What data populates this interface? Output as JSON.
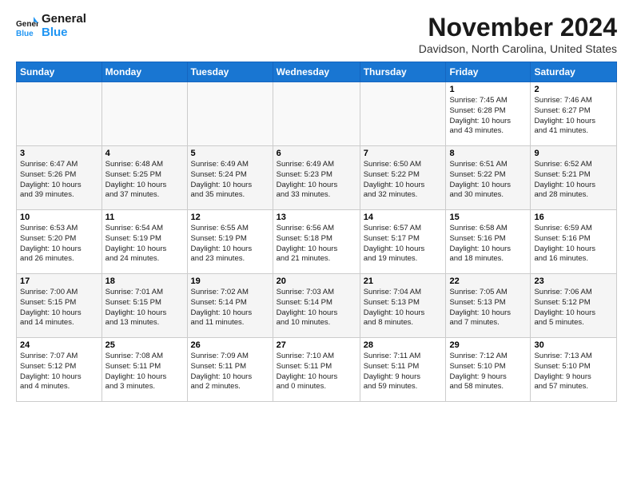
{
  "logo": {
    "line1": "General",
    "line2": "Blue"
  },
  "title": "November 2024",
  "subtitle": "Davidson, North Carolina, United States",
  "header": {
    "days": [
      "Sunday",
      "Monday",
      "Tuesday",
      "Wednesday",
      "Thursday",
      "Friday",
      "Saturday"
    ]
  },
  "weeks": [
    [
      {
        "day": "",
        "info": ""
      },
      {
        "day": "",
        "info": ""
      },
      {
        "day": "",
        "info": ""
      },
      {
        "day": "",
        "info": ""
      },
      {
        "day": "",
        "info": ""
      },
      {
        "day": "1",
        "info": "Sunrise: 7:45 AM\nSunset: 6:28 PM\nDaylight: 10 hours\nand 43 minutes."
      },
      {
        "day": "2",
        "info": "Sunrise: 7:46 AM\nSunset: 6:27 PM\nDaylight: 10 hours\nand 41 minutes."
      }
    ],
    [
      {
        "day": "3",
        "info": "Sunrise: 6:47 AM\nSunset: 5:26 PM\nDaylight: 10 hours\nand 39 minutes."
      },
      {
        "day": "4",
        "info": "Sunrise: 6:48 AM\nSunset: 5:25 PM\nDaylight: 10 hours\nand 37 minutes."
      },
      {
        "day": "5",
        "info": "Sunrise: 6:49 AM\nSunset: 5:24 PM\nDaylight: 10 hours\nand 35 minutes."
      },
      {
        "day": "6",
        "info": "Sunrise: 6:49 AM\nSunset: 5:23 PM\nDaylight: 10 hours\nand 33 minutes."
      },
      {
        "day": "7",
        "info": "Sunrise: 6:50 AM\nSunset: 5:22 PM\nDaylight: 10 hours\nand 32 minutes."
      },
      {
        "day": "8",
        "info": "Sunrise: 6:51 AM\nSunset: 5:22 PM\nDaylight: 10 hours\nand 30 minutes."
      },
      {
        "day": "9",
        "info": "Sunrise: 6:52 AM\nSunset: 5:21 PM\nDaylight: 10 hours\nand 28 minutes."
      }
    ],
    [
      {
        "day": "10",
        "info": "Sunrise: 6:53 AM\nSunset: 5:20 PM\nDaylight: 10 hours\nand 26 minutes."
      },
      {
        "day": "11",
        "info": "Sunrise: 6:54 AM\nSunset: 5:19 PM\nDaylight: 10 hours\nand 24 minutes."
      },
      {
        "day": "12",
        "info": "Sunrise: 6:55 AM\nSunset: 5:19 PM\nDaylight: 10 hours\nand 23 minutes."
      },
      {
        "day": "13",
        "info": "Sunrise: 6:56 AM\nSunset: 5:18 PM\nDaylight: 10 hours\nand 21 minutes."
      },
      {
        "day": "14",
        "info": "Sunrise: 6:57 AM\nSunset: 5:17 PM\nDaylight: 10 hours\nand 19 minutes."
      },
      {
        "day": "15",
        "info": "Sunrise: 6:58 AM\nSunset: 5:16 PM\nDaylight: 10 hours\nand 18 minutes."
      },
      {
        "day": "16",
        "info": "Sunrise: 6:59 AM\nSunset: 5:16 PM\nDaylight: 10 hours\nand 16 minutes."
      }
    ],
    [
      {
        "day": "17",
        "info": "Sunrise: 7:00 AM\nSunset: 5:15 PM\nDaylight: 10 hours\nand 14 minutes."
      },
      {
        "day": "18",
        "info": "Sunrise: 7:01 AM\nSunset: 5:15 PM\nDaylight: 10 hours\nand 13 minutes."
      },
      {
        "day": "19",
        "info": "Sunrise: 7:02 AM\nSunset: 5:14 PM\nDaylight: 10 hours\nand 11 minutes."
      },
      {
        "day": "20",
        "info": "Sunrise: 7:03 AM\nSunset: 5:14 PM\nDaylight: 10 hours\nand 10 minutes."
      },
      {
        "day": "21",
        "info": "Sunrise: 7:04 AM\nSunset: 5:13 PM\nDaylight: 10 hours\nand 8 minutes."
      },
      {
        "day": "22",
        "info": "Sunrise: 7:05 AM\nSunset: 5:13 PM\nDaylight: 10 hours\nand 7 minutes."
      },
      {
        "day": "23",
        "info": "Sunrise: 7:06 AM\nSunset: 5:12 PM\nDaylight: 10 hours\nand 5 minutes."
      }
    ],
    [
      {
        "day": "24",
        "info": "Sunrise: 7:07 AM\nSunset: 5:12 PM\nDaylight: 10 hours\nand 4 minutes."
      },
      {
        "day": "25",
        "info": "Sunrise: 7:08 AM\nSunset: 5:11 PM\nDaylight: 10 hours\nand 3 minutes."
      },
      {
        "day": "26",
        "info": "Sunrise: 7:09 AM\nSunset: 5:11 PM\nDaylight: 10 hours\nand 2 minutes."
      },
      {
        "day": "27",
        "info": "Sunrise: 7:10 AM\nSunset: 5:11 PM\nDaylight: 10 hours\nand 0 minutes."
      },
      {
        "day": "28",
        "info": "Sunrise: 7:11 AM\nSunset: 5:11 PM\nDaylight: 9 hours\nand 59 minutes."
      },
      {
        "day": "29",
        "info": "Sunrise: 7:12 AM\nSunset: 5:10 PM\nDaylight: 9 hours\nand 58 minutes."
      },
      {
        "day": "30",
        "info": "Sunrise: 7:13 AM\nSunset: 5:10 PM\nDaylight: 9 hours\nand 57 minutes."
      }
    ]
  ]
}
